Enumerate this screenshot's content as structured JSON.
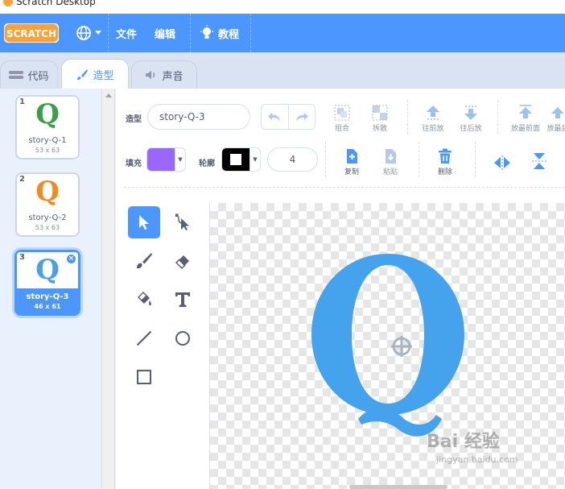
{
  "window": {
    "title": "Scratch Desktop"
  },
  "menubar": {
    "logo": "SCRATCH",
    "file_label": "文件",
    "edit_label": "编辑",
    "tutorials_label": "教程"
  },
  "tabs": [
    {
      "label": "代码",
      "active": false
    },
    {
      "label": "造型",
      "active": true
    },
    {
      "label": "声音",
      "active": false
    }
  ],
  "costumes": [
    {
      "num": "1",
      "glyph": "Q",
      "name": "story-Q-1",
      "size": "53 x 63",
      "color": "#3aa046",
      "selected": false
    },
    {
      "num": "2",
      "glyph": "Q",
      "name": "story-Q-2",
      "size": "53 x 63",
      "color": "#f28a1e",
      "selected": false
    },
    {
      "num": "3",
      "glyph": "Q",
      "name": "story-Q-3",
      "size": "46 x 61",
      "color": "#4aa0e8",
      "selected": true
    }
  ],
  "editor": {
    "costume_label": "造型",
    "costume_name": "story-Q-3",
    "fill_label": "填充",
    "fill_color": "#9966ff",
    "outline_label": "轮廓",
    "outline_color": "#000000",
    "outline_width": "4",
    "buttons": {
      "group": "组合",
      "ungroup": "拆散",
      "forward": "往前放",
      "backward": "往后放",
      "front": "放最前面",
      "back": "放最后",
      "copy": "复制",
      "paste": "粘贴",
      "delete": "删除"
    }
  },
  "watermark": {
    "brand": "Bai 经验",
    "url": "jingyan.baidu.com"
  },
  "colors": {
    "accent": "#4c97ff",
    "tool_icon": "#575e75",
    "shape": "#45a3ee"
  }
}
